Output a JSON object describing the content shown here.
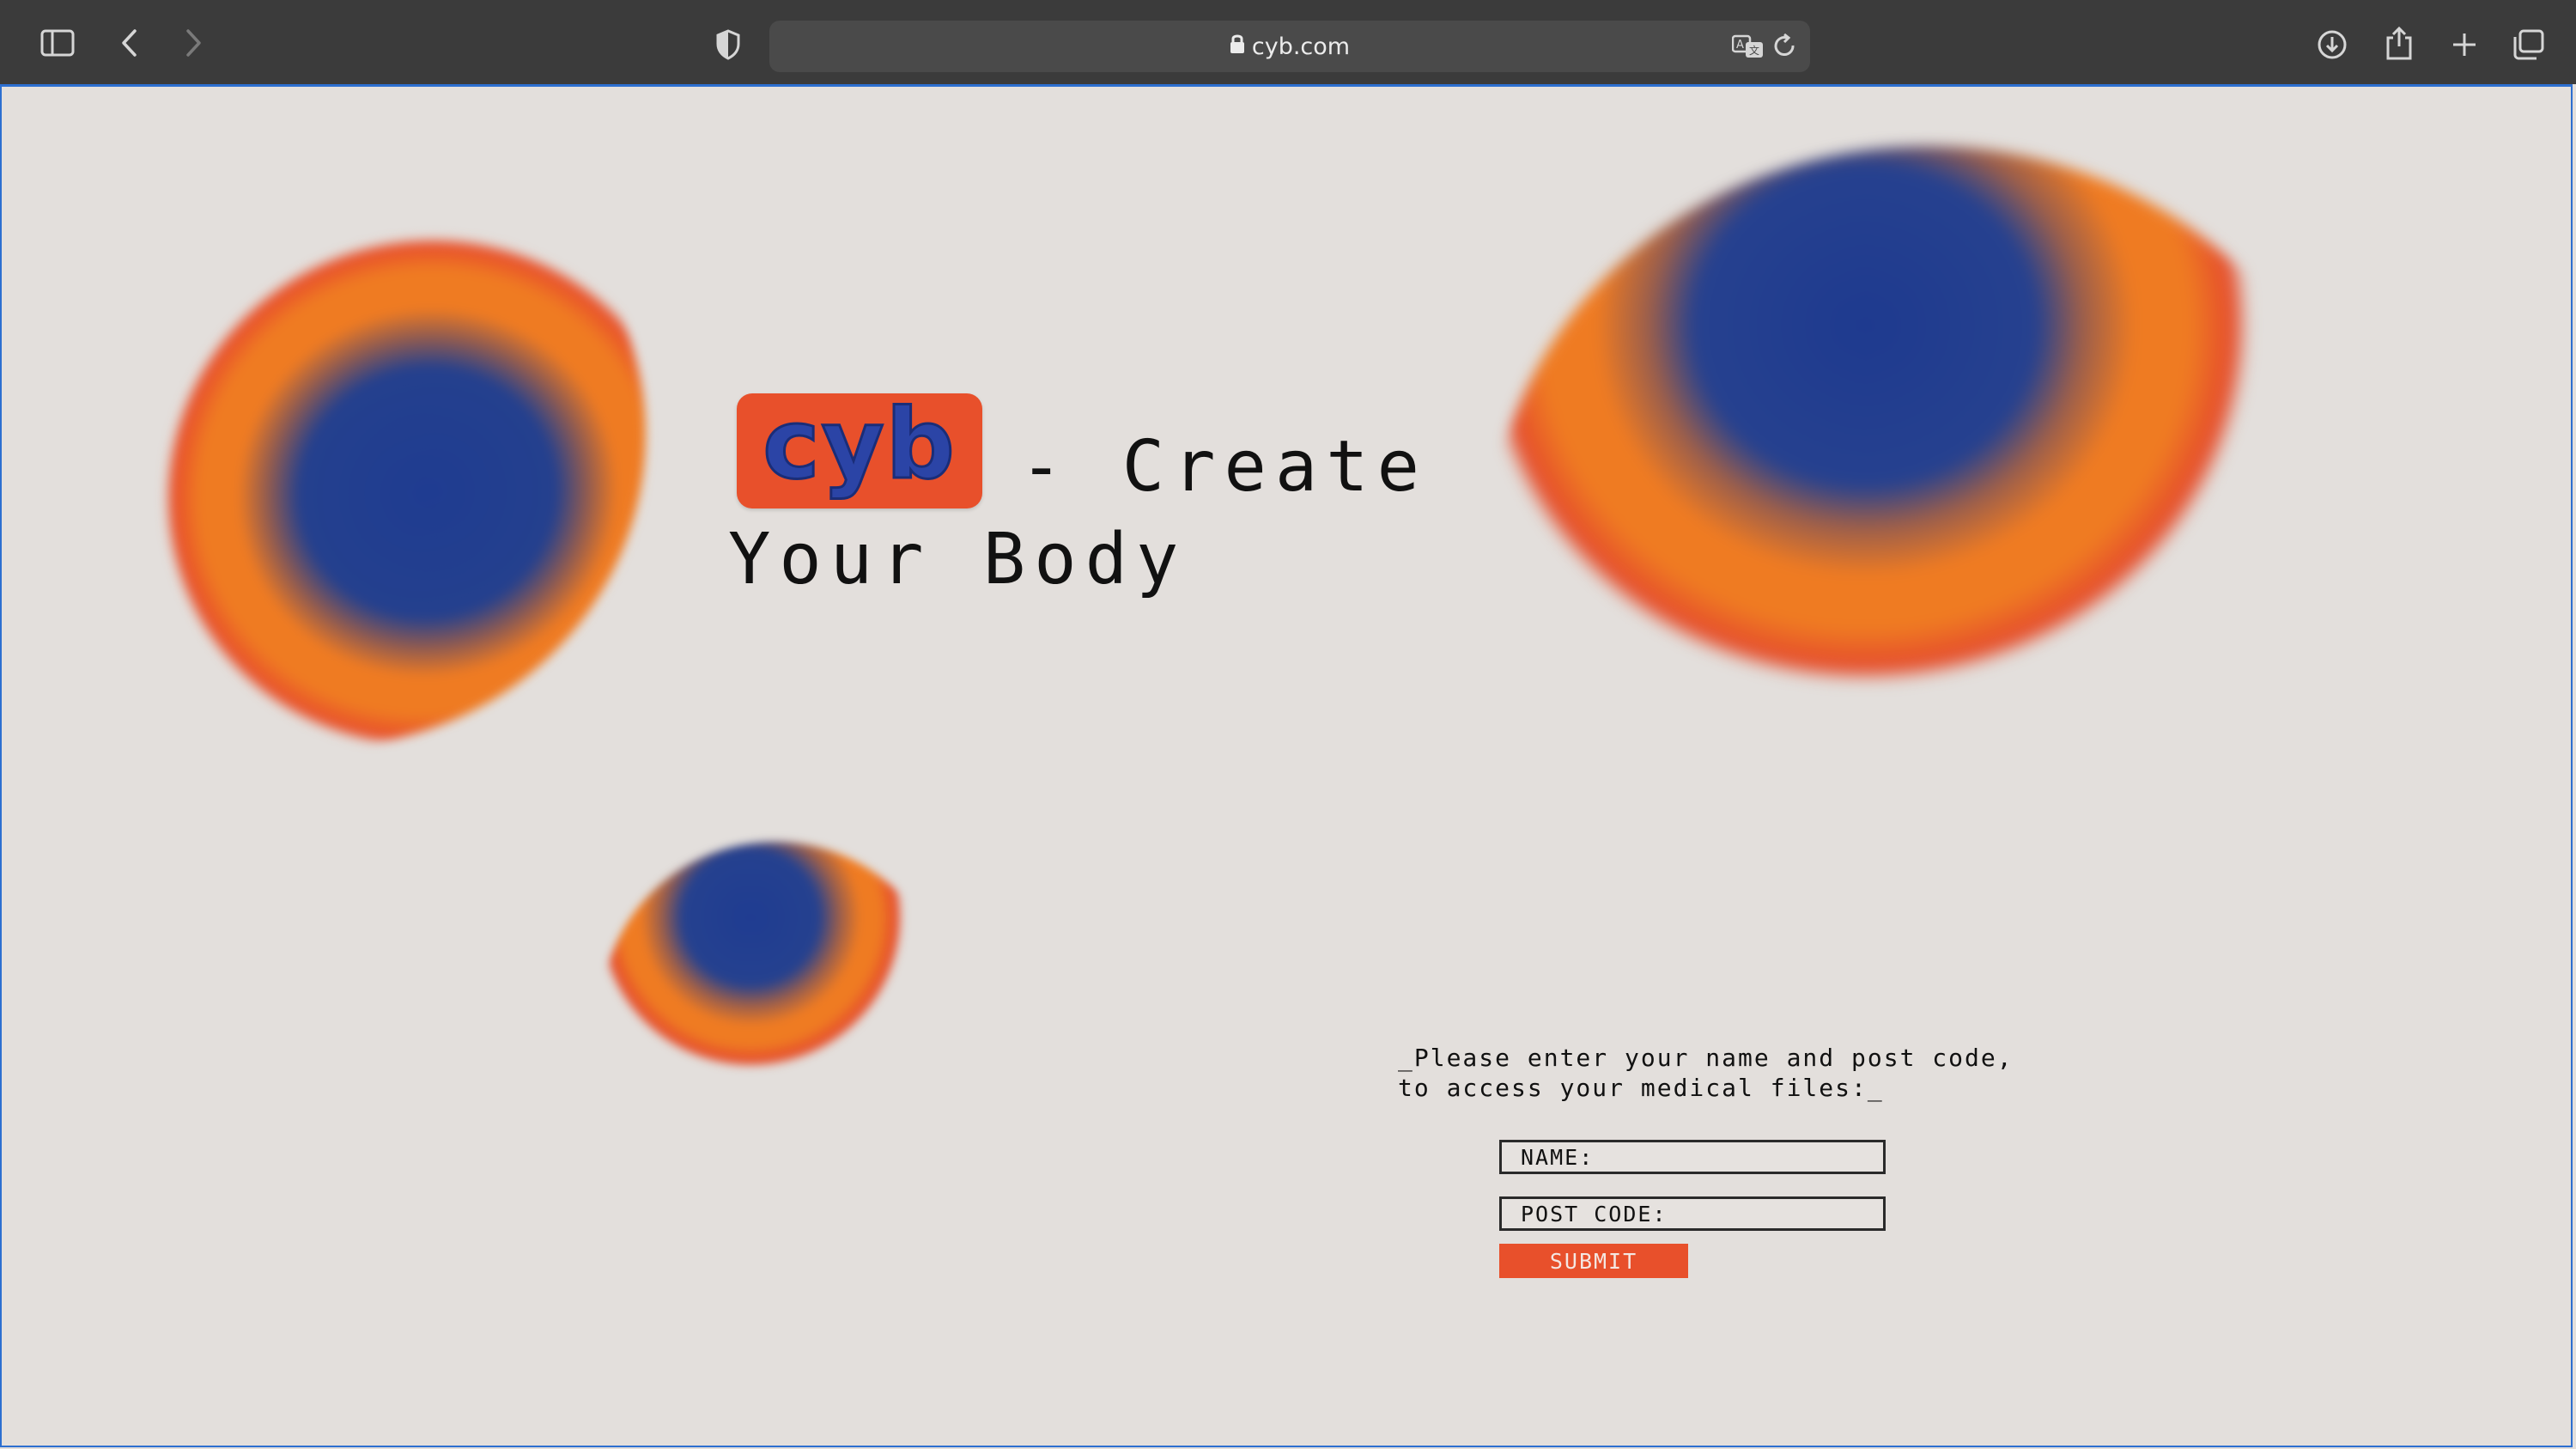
{
  "browser": {
    "url": "cyb.com",
    "icons": {
      "sidebar": "sidebar-icon",
      "back": "chevron-left-icon",
      "forward": "chevron-right-icon",
      "privacy": "shield-icon",
      "lock": "lock-icon",
      "translate": "translate-icon",
      "reload": "reload-icon",
      "downloads": "download-icon",
      "share": "share-icon",
      "new_tab": "plus-icon",
      "tabs": "tabs-overview-icon"
    }
  },
  "hero": {
    "logo_text": "cyb",
    "title_line1": "- Create",
    "title_line2": "Your Body"
  },
  "form": {
    "prompt": "_Please enter your name and post code,\nto access your medical files:_",
    "name_placeholder": "NAME:",
    "postcode_placeholder": "POST CODE:",
    "submit_label": "SUBMIT"
  },
  "colors": {
    "background": "#e3dfdc",
    "accent_orange": "#e8502b",
    "accent_blue": "#1f3c91",
    "chrome": "#3b3b3b"
  }
}
